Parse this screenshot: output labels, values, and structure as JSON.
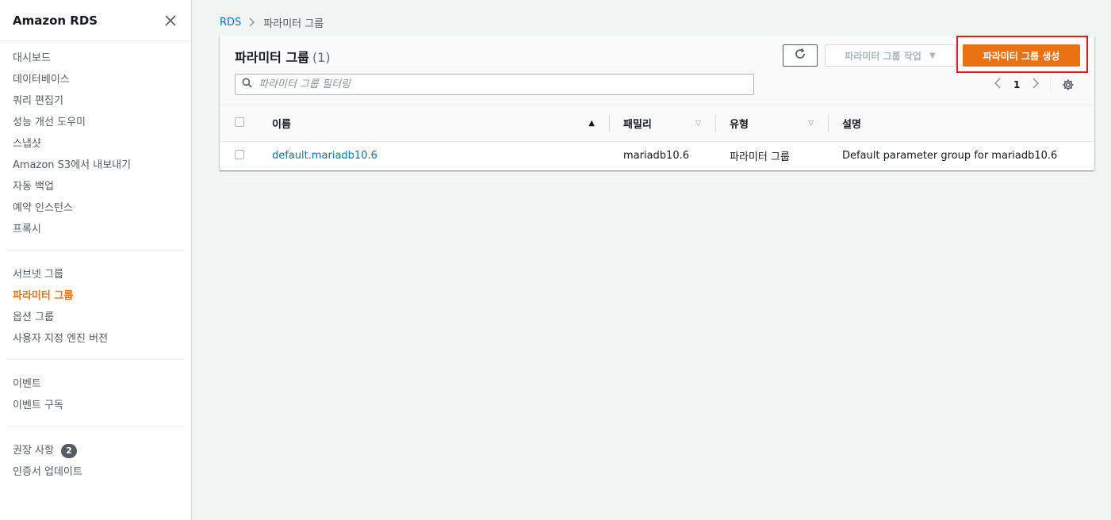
{
  "sidebar": {
    "title": "Amazon RDS",
    "groups": [
      {
        "items": [
          "대시보드",
          "데이터베이스",
          "쿼리 편집기",
          "성능 개선 도우미",
          "스냅샷",
          "Amazon S3에서 내보내기",
          "자동 백업",
          "예약 인스턴스",
          "프록시"
        ]
      },
      {
        "items": [
          "서브넷 그룹",
          "파라미터 그룹",
          "옵션 그룹",
          "사용자 지정 엔진 버전"
        ]
      },
      {
        "items": [
          "이벤트",
          "이벤트 구독"
        ]
      },
      {
        "items": [
          "권장 사항",
          "인증서 업데이트"
        ]
      }
    ],
    "active_item": "파라미터 그룹",
    "recommendations_badge": "2"
  },
  "breadcrumb": {
    "root": "RDS",
    "current": "파라미터 그룹"
  },
  "panel": {
    "title": "파라미터 그룹",
    "count": "(1)",
    "actions_label": "파라미터 그룹 작업",
    "create_label": "파라미터 그룹 생성",
    "search_placeholder": "파라미터 그룹 필터링",
    "page": "1"
  },
  "table": {
    "columns": [
      "이름",
      "패밀리",
      "유형",
      "설명"
    ],
    "rows": [
      {
        "name": "default.mariadb10.6",
        "family": "mariadb10.6",
        "type": "파라미터 그룹",
        "description": "Default parameter group for mariadb10.6"
      }
    ]
  },
  "colors": {
    "accent": "#ec7211",
    "link": "#0073bb",
    "highlight_border": "#e02020"
  }
}
